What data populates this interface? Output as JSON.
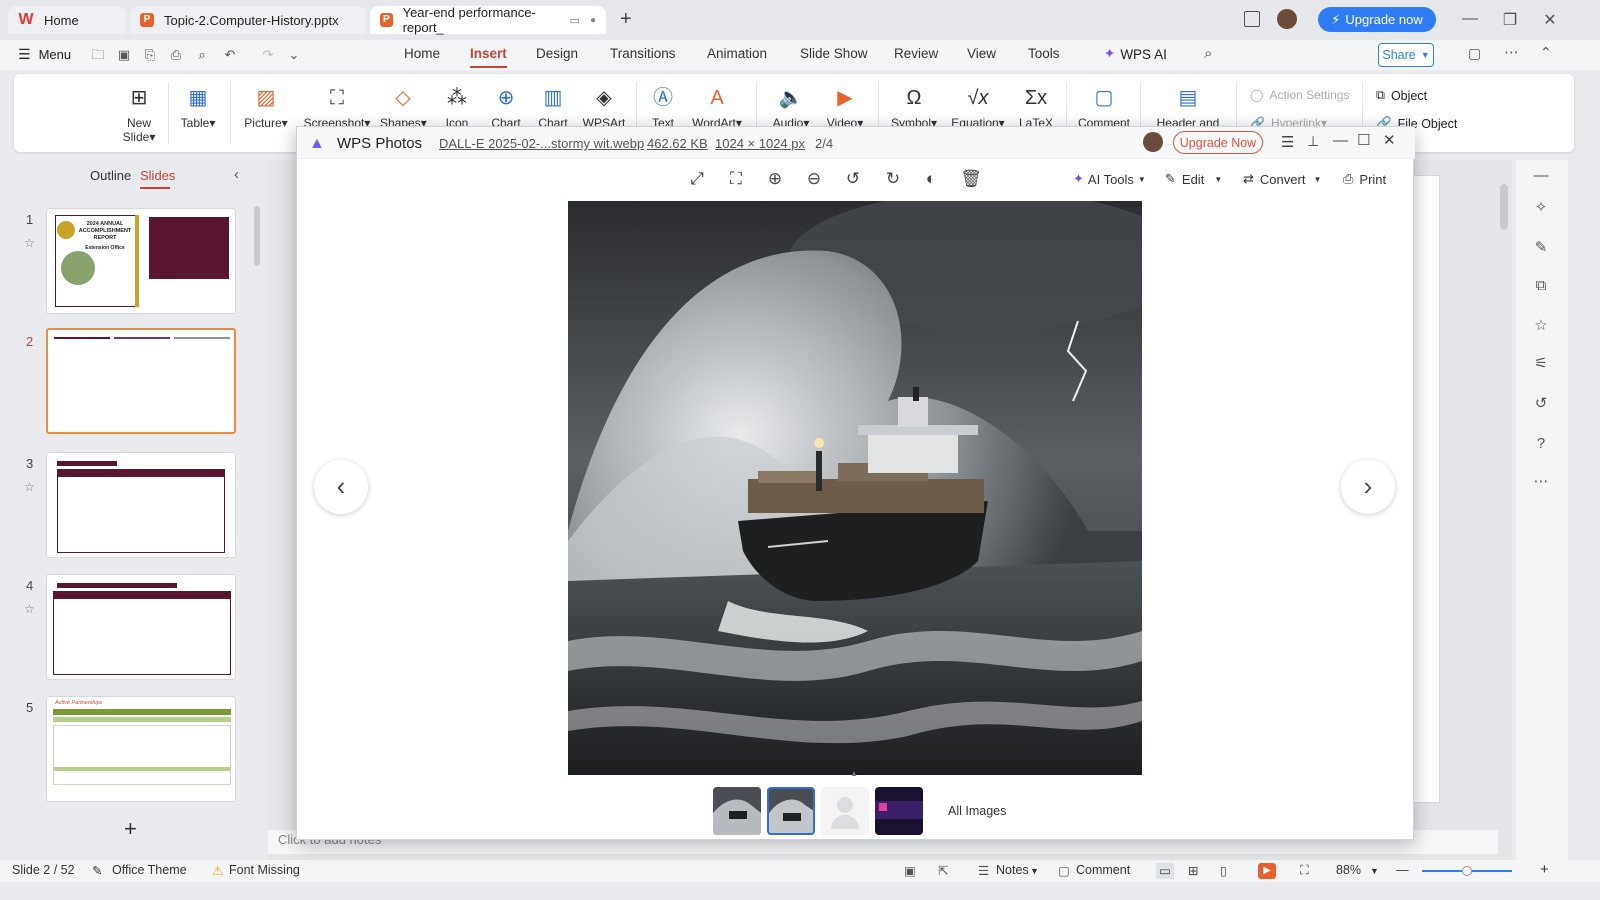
{
  "titlebar": {
    "tabs": [
      {
        "label": "Home",
        "icon": "wps-logo"
      },
      {
        "label": "Topic-2.Computer-History.pptx",
        "icon": "ppt-logo"
      },
      {
        "label": "Year-end performance-report_",
        "icon": "ppt-logo"
      }
    ],
    "upgrade_label": "Upgrade now"
  },
  "menubar": {
    "menu_label": "Menu",
    "tabs": [
      "Home",
      "Insert",
      "Design",
      "Transitions",
      "Animation",
      "Slide Show",
      "Review",
      "View",
      "Tools"
    ],
    "active_tab": "Insert",
    "wps_ai_label": "WPS AI",
    "share_label": "Share"
  },
  "ribbon": {
    "new_slide": "New",
    "new_slide_2": "Slide",
    "table": "Table",
    "picture": "Picture",
    "screenshot": "Screenshot",
    "shapes": "Shapes",
    "icon": "Icon",
    "chart": "Chart",
    "smartart": "Chart",
    "wpsart": "WPSArt",
    "text": "Text",
    "wordart": "WordArt",
    "audio": "Audio",
    "video": "Video",
    "symbol": "Symbol",
    "equation": "Equation",
    "latex": "LaTeX",
    "comment": "Comment",
    "header_footer": "Header and",
    "action_settings": "Action Settings",
    "hyperlink": "Hyperlink",
    "object": "Object",
    "file_object": "File Object"
  },
  "leftpanel": {
    "outline_label": "Outline",
    "slides_label": "Slides",
    "slides": [
      "1",
      "2",
      "3",
      "4",
      "5"
    ],
    "thumb1_title": "2024 ANNUAL ACCOMPLISHMENT REPORT",
    "thumb1_sub": "Extension Office",
    "thumb5_header": "Active Partnerships"
  },
  "editor": {
    "notes_placeholder": "Click to add notes"
  },
  "viewer": {
    "app_name": "WPS Photos",
    "file_name": "DALL-E 2025-02-...stormy wit.webp",
    "file_size": "462.62 KB",
    "dimensions": "1024 × 1024 px",
    "position": "2/4",
    "upgrade_label": "Upgrade Now",
    "ai_tools": "AI Tools",
    "edit": "Edit",
    "convert": "Convert",
    "print": "Print",
    "all_images": "All Images"
  },
  "statusbar": {
    "slide_info": "Slide 2 / 52",
    "theme": "Office Theme",
    "font_missing": "Font Missing",
    "notes": "Notes",
    "comment": "Comment",
    "zoom": "88%"
  },
  "colors": {
    "accent_red": "#c8433a",
    "upgrade_blue": "#2f7cf6",
    "selection_orange": "#f08a3c",
    "slide_maroon": "#5a1530"
  }
}
